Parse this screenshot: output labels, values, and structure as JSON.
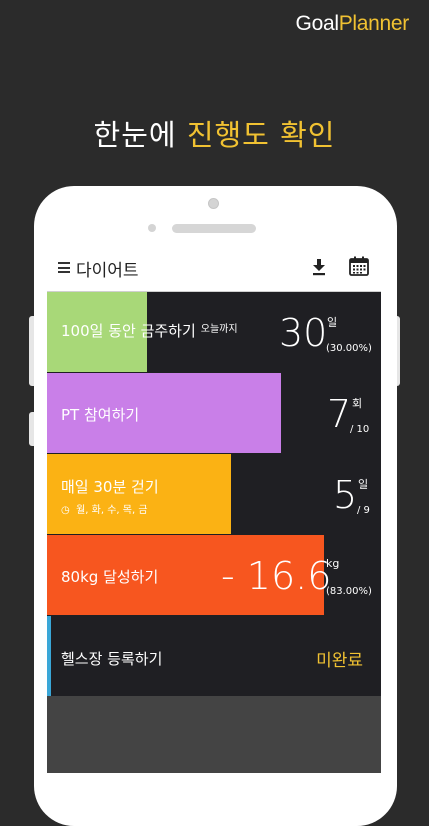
{
  "brand": {
    "part1": "Goal",
    "part2": "Planner"
  },
  "headline": {
    "part1": "한눈에 ",
    "part2": "진행도 확인"
  },
  "app": {
    "title": "다이어트",
    "icons": [
      "menu-icon",
      "download-icon",
      "calendar-icon"
    ]
  },
  "goals": [
    {
      "label": "100일 동안 금주하기",
      "suffix": "오늘까지",
      "value": "30",
      "unit": "일",
      "sub": "(30.00%)",
      "progress": 0.3,
      "color": "#a8d878"
    },
    {
      "label": "PT 참여하기",
      "value": "7",
      "unit": "회",
      "sub": "/ 10",
      "progress": 0.7,
      "color": "#c97fe8"
    },
    {
      "label": "매일 30분 걷기",
      "days": "월, 화, 수, 목, 금",
      "value": "5",
      "unit": "일",
      "sub": "/ 9",
      "progress": 0.55,
      "color": "#fbb214"
    },
    {
      "label": "80kg 달성하기",
      "value": "- 16.6",
      "unit": "kg",
      "sub": "(83.00%)",
      "progress": 0.83,
      "color": "#f7561f"
    }
  ],
  "pending_goal": {
    "label": "헬스장 등록하기",
    "status": "미완료",
    "accent": "#3aa7d8"
  }
}
